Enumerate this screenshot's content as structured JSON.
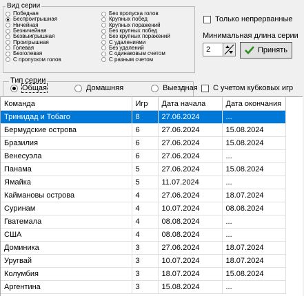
{
  "series_kind": {
    "legend": "Вид серии",
    "left_options": [
      "Победная",
      "Беспроигрышная",
      "Ничейная",
      "Безничейная",
      "Безвыигрышная",
      "Проигрышная",
      "Голевая",
      "Безголевая",
      "С пропуском голов"
    ],
    "right_options": [
      "Без пропуска голов",
      "Крупных побед",
      "Крупных поражений",
      "Без крупных побед",
      "Без крупных поражений",
      "С удалениями",
      "Без удалений",
      "С одинаковым счетом",
      "С разным счетом"
    ],
    "selected": "Беспроигрышная"
  },
  "options": {
    "uninterrupted_label": "Только непрерванные",
    "min_length_label": "Минимальная длина серии",
    "min_length_value": "2",
    "apply_label": "Принять",
    "cup_games_label": "С учетом кубковых игр"
  },
  "series_type": {
    "legend": "Тип серии",
    "options": [
      "Общая",
      "Домашняя",
      "Выездная"
    ],
    "selected": "Общая"
  },
  "table": {
    "columns": [
      "Команда",
      "Игр",
      "Дата начала",
      "Дата окончания"
    ],
    "rows": [
      [
        "Тринидад и Тобаго",
        "8",
        "27.06.2024",
        "..."
      ],
      [
        "Бермудские острова",
        "6",
        "27.06.2024",
        "15.08.2024"
      ],
      [
        "Бразилия",
        "6",
        "27.06.2024",
        "15.08.2024"
      ],
      [
        "Венесуэла",
        "6",
        "27.06.2024",
        "..."
      ],
      [
        "Панама",
        "5",
        "27.06.2024",
        "15.08.2024"
      ],
      [
        "Ямайка",
        "5",
        "11.07.2024",
        "..."
      ],
      [
        "Каймановы острова",
        "4",
        "27.06.2024",
        "18.07.2024"
      ],
      [
        "Суринам",
        "4",
        "10.07.2024",
        "08.08.2024"
      ],
      [
        "Гватемала",
        "4",
        "08.08.2024",
        "..."
      ],
      [
        "США",
        "4",
        "08.08.2024",
        "..."
      ],
      [
        "Доминика",
        "3",
        "27.06.2024",
        "18.07.2024"
      ],
      [
        "Уругвай",
        "3",
        "10.07.2024",
        "18.07.2024"
      ],
      [
        "Колумбия",
        "3",
        "18.07.2024",
        "15.08.2024"
      ],
      [
        "Аргентина",
        "3",
        "15.08.2024",
        "..."
      ]
    ],
    "selected_row": 0
  }
}
